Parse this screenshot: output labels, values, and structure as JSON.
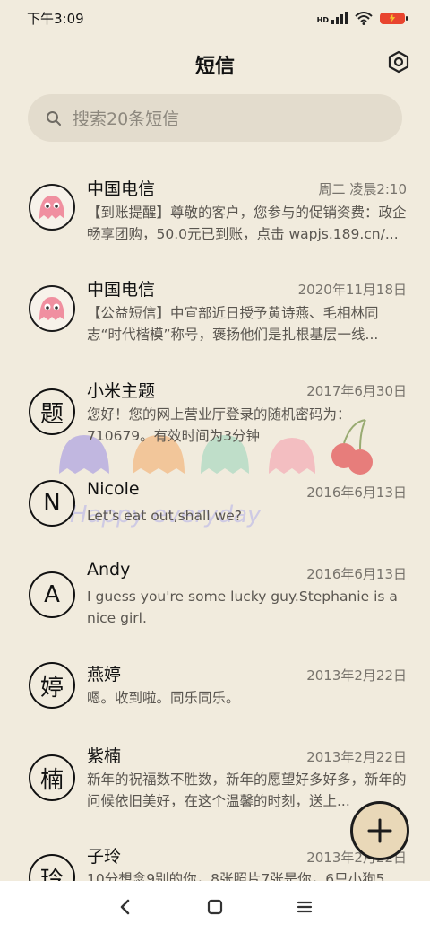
{
  "status_bar": {
    "time": "下午3:09",
    "network_label": "HD",
    "signal_icon": "signal-icon",
    "wifi_icon": "wifi-icon",
    "battery_icon": "battery-charging-icon"
  },
  "header": {
    "title": "短信",
    "settings_icon": "settings-hexagon-icon"
  },
  "search": {
    "placeholder": "搜索20条短信",
    "icon": "search-icon"
  },
  "conversations": [
    {
      "avatar": "ghost",
      "name": "中国电信",
      "date": "周二 凌晨2:10",
      "preview": "【到账提醒】尊敬的客户，您参与的促销资费：政企畅享团购，50.0元已到账，点击 wapjs.189.cn/..."
    },
    {
      "avatar": "ghost",
      "name": "中国电信",
      "date": "2020年11月18日",
      "preview": "【公益短信】中宣部近日授予黄诗燕、毛相林同志“时代楷模”称号，褒扬他们是扎根基层一线..."
    },
    {
      "avatar": "题",
      "name": "小米主题",
      "date": "2017年6月30日",
      "preview": "您好！您的网上营业厅登录的随机密码为：710679。有效时间为3分钟"
    },
    {
      "avatar": "N",
      "name": "Nicole",
      "date": "2016年6月13日",
      "preview": "Let's eat out,shall we?"
    },
    {
      "avatar": "A",
      "name": "Andy",
      "date": "2016年6月13日",
      "preview": "I guess you're some lucky guy.Stephanie is a nice girl."
    },
    {
      "avatar": "婷",
      "name": "燕婷",
      "date": "2013年2月22日",
      "preview": "嗯。收到啦。同乐同乐。"
    },
    {
      "avatar": "楠",
      "name": "紫楠",
      "date": "2013年2月22日",
      "preview": "新年的祝福数不胜数，新年的愿望好多好多，新年的问候依旧美好，在这个温馨的时刻，送上..."
    },
    {
      "avatar": "玲",
      "name": "子玲",
      "date": "2013年2月22日",
      "preview": "10分想念9别的你，8张照片7张是你，6只小狗5..."
    }
  ],
  "decoration": {
    "text": "Happy everyday",
    "colors": {
      "purple": "#b9aee0",
      "orange": "#f3c08f",
      "green": "#b7dcc6",
      "pink": "#f4b7bd",
      "cherry": "#e66a6a"
    }
  },
  "fab": {
    "icon": "plus-icon"
  },
  "nav_bar": {
    "back_icon": "back-chevron-icon",
    "home_icon": "home-square-icon",
    "menu_icon": "menu-lines-icon"
  },
  "colors": {
    "background": "#f1ebdd",
    "search_bg": "#e3dccd",
    "fab_bg": "#e9d8b8"
  }
}
